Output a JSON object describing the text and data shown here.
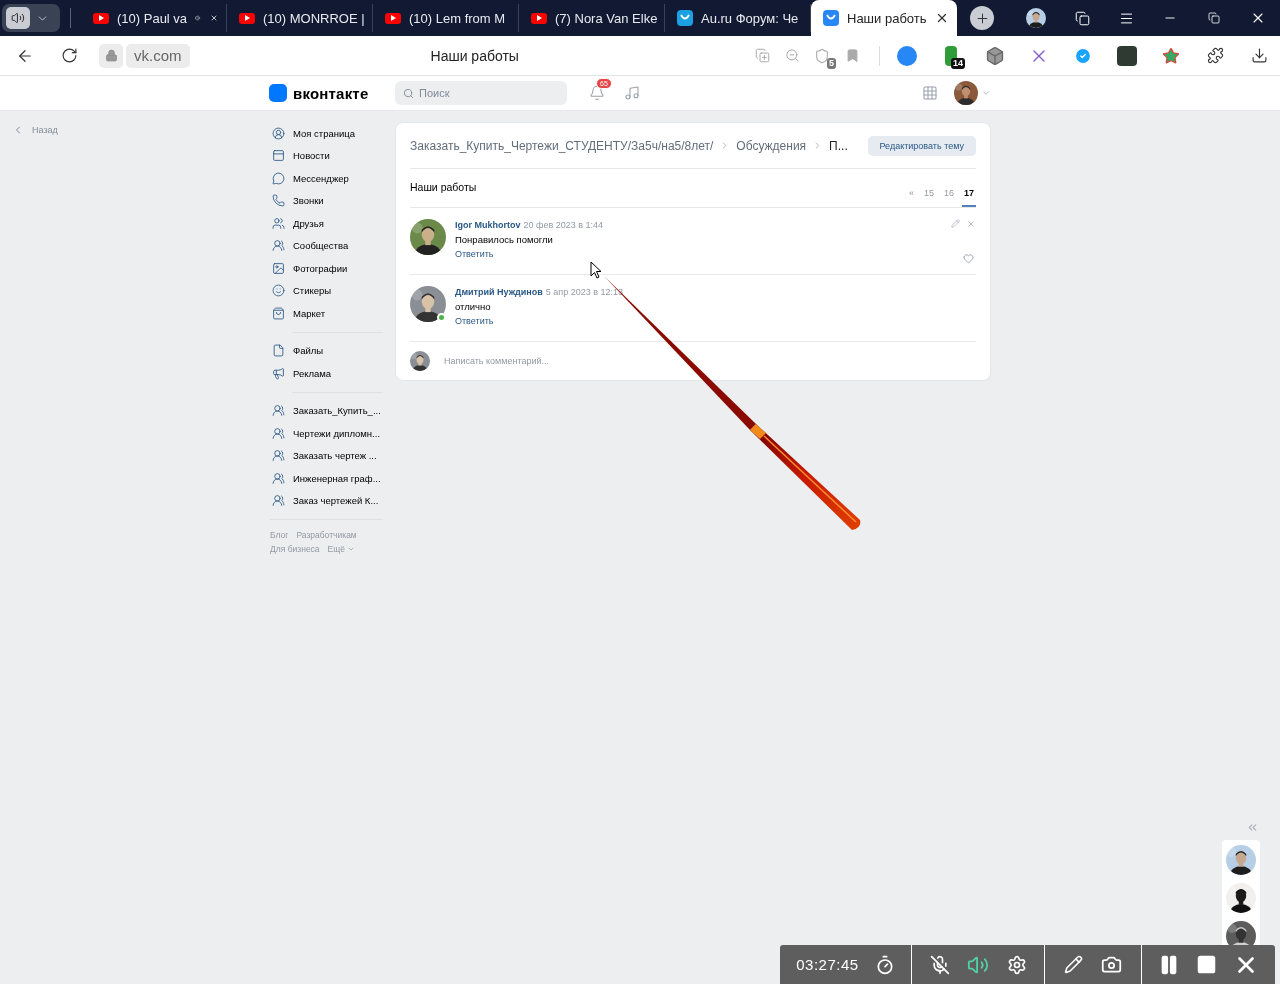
{
  "browser": {
    "tabs": [
      {
        "title": "(10) Paul va",
        "kind": "youtube",
        "selected": false,
        "audio": true,
        "closable": true
      },
      {
        "title": "(10) MONRROE |",
        "kind": "youtube",
        "selected": false,
        "audio": false,
        "closable": false
      },
      {
        "title": "(10) Lem from M",
        "kind": "youtube",
        "selected": false,
        "audio": false,
        "closable": false
      },
      {
        "title": "(7) Nora Van Elke",
        "kind": "youtube",
        "selected": false,
        "audio": false,
        "closable": false
      },
      {
        "title": "Au.ru Форум: Че",
        "kind": "forum",
        "selected": false,
        "audio": false,
        "closable": false
      },
      {
        "title": "Наши работь",
        "kind": "vk",
        "selected": true,
        "audio": false,
        "closable": true
      }
    ],
    "address": "vk.com",
    "page_title": "Наши работы",
    "shield_badge": "5",
    "extension_badge": "14"
  },
  "header": {
    "logo_text": "вконтакте",
    "search": {
      "placeholder": "Поиск"
    },
    "notifications": "65"
  },
  "back_link": "Назад",
  "sidebar": {
    "sections": [
      [
        "Моя страница",
        "Новости",
        "Мессенджер",
        "Звонки",
        "Друзья",
        "Сообщества",
        "Фотографии",
        "Стикеры",
        "Маркет"
      ],
      [
        "Файлы",
        "Реклама"
      ],
      [
        "Заказать_Купить_...",
        "Чертежи дипломн...",
        "Заказать чертеж ...",
        "Инженерная граф...",
        "Заказ чертежей К..."
      ]
    ],
    "footer": [
      [
        "Блог",
        "Разработчикам"
      ],
      [
        "Для бизнеса",
        "Ещё"
      ]
    ]
  },
  "topic": {
    "breadcrumbs": [
      "Заказать_Купить_Чертежи_СТУДЕНТУ/За5ч/на5/8лет/",
      "Обсуждения",
      "П..."
    ],
    "edit_button": "Редактировать тему",
    "title": "Наши работы",
    "pages": [
      {
        "label": "«",
        "selected": false
      },
      {
        "label": "15",
        "selected": false
      },
      {
        "label": "16",
        "selected": false
      },
      {
        "label": "17",
        "selected": true
      }
    ],
    "comments": [
      {
        "author": "Igor Mukhortov",
        "date": "20 фев 2023 в 1:44",
        "text": "Понравилось помогли",
        "reply": "Ответить",
        "online": false,
        "actions_visible": true
      },
      {
        "author": "Дмитрий Нуждинов",
        "date": "5 апр 2023 в 12:13",
        "text": "отлично",
        "reply": "Ответить",
        "online": true,
        "actions_visible": false
      }
    ],
    "comment_placeholder": "Написать комментарий..."
  },
  "recorder": {
    "time": "03:27:45",
    "mic_muted": true
  }
}
